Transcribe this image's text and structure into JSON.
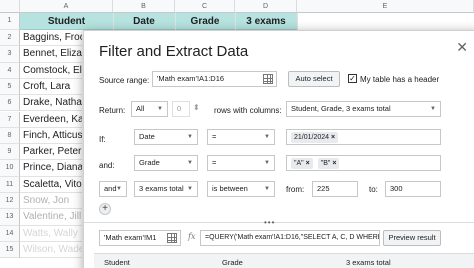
{
  "sheet": {
    "col_letters": [
      "A",
      "B",
      "C",
      "D",
      "E"
    ],
    "row_numbers": [
      "1",
      "2",
      "3",
      "4",
      "5",
      "6",
      "7",
      "8",
      "9",
      "10",
      "11",
      "12",
      "13",
      "14",
      "15"
    ],
    "headers": [
      "Student",
      "Date",
      "Grade",
      "3 exams total"
    ],
    "students": [
      "Baggins, Froc",
      "Bennet, Eliza",
      "Comstock, Eli",
      "Croft, Lara",
      "Drake, Natha",
      "Everdeen, Ka",
      "Finch, Atticus",
      "Parker, Peter",
      "Prince, Diana",
      "Scaletta, Vito",
      "Snow, Jon",
      "Valentine, Jill",
      "Watts, Wally",
      "Wilson, Wade"
    ]
  },
  "dialog": {
    "title": "Filter and Extract Data",
    "close_icon": "close-icon",
    "source_label": "Source range:",
    "source_value": "'Math exam'!A1:D16",
    "auto_select_label": "Auto select",
    "header_checkbox_label": "My table has a header",
    "header_checkbox_checked": "✓",
    "return_label": "Return:",
    "return_value": "All",
    "return_count": "0",
    "rows_with_columns_label": "rows with columns:",
    "columns_value": "Student, Grade, 3 exams total",
    "conditions": [
      {
        "prefix": "If:",
        "column": "Date",
        "operator": "=",
        "values": [
          "21/01/2024"
        ],
        "remove": "×"
      },
      {
        "prefix": "and:",
        "column": "Grade",
        "operator": "=",
        "values": [
          "\"A\"",
          "\"B\""
        ],
        "remove": "×"
      },
      {
        "prefix": "and",
        "column": "3 exams total",
        "operator": "is between",
        "from_label": "from:",
        "from_value": "225",
        "to_label": "to:",
        "to_value": "300"
      }
    ],
    "add_condition": "+",
    "splitter_dots": "•••",
    "output_range": "'Math exam'!M1",
    "fx_label": "fx",
    "formula": "=QUERY('Math exam'!A1:D16,\"SELECT A, C, D WHERE ((B",
    "preview_button": "Preview result",
    "preview_columns": [
      "Student",
      "Grade",
      "3 exams total"
    ]
  },
  "colors": {
    "header_fill": "#b6e3df",
    "dialog_bg": "#ffffff",
    "chip_bg": "#e8eaed"
  }
}
